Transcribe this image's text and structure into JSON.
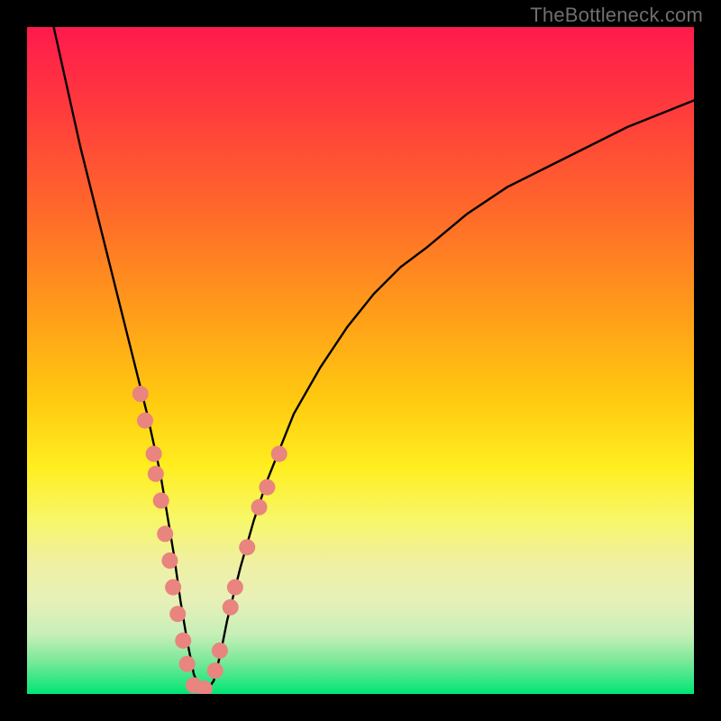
{
  "watermark": "TheBottleneck.com",
  "chart_data": {
    "type": "line",
    "title": "",
    "xlabel": "",
    "ylabel": "",
    "x_range": [
      0,
      100
    ],
    "y_range": [
      0,
      100
    ],
    "gradient_stops": [
      {
        "pos": 0,
        "color": "#ff1a4d"
      },
      {
        "pos": 28,
        "color": "#ff6a2a"
      },
      {
        "pos": 56,
        "color": "#ffca10"
      },
      {
        "pos": 74,
        "color": "#f7f76a"
      },
      {
        "pos": 95,
        "color": "#7de89a"
      },
      {
        "pos": 100,
        "color": "#00e676"
      }
    ],
    "series": [
      {
        "name": "bottleneck-curve",
        "x": [
          4,
          6,
          8,
          10,
          12,
          14,
          16,
          18,
          20,
          21,
          22,
          23,
          24,
          25,
          26,
          27,
          28,
          29,
          30,
          32,
          34,
          36,
          38,
          40,
          44,
          48,
          52,
          56,
          60,
          66,
          72,
          80,
          90,
          100
        ],
        "y": [
          100,
          91,
          82,
          74,
          66,
          58,
          50,
          42,
          33,
          27,
          21,
          14,
          8,
          3,
          0.5,
          0.5,
          2,
          6,
          11,
          19,
          26,
          32,
          37,
          42,
          49,
          55,
          60,
          64,
          67,
          72,
          76,
          80,
          85,
          89
        ]
      }
    ],
    "marker_clusters": [
      {
        "name": "left-arm-dots",
        "color": "#e9847e",
        "points": [
          {
            "x": 17.0,
            "y": 45
          },
          {
            "x": 17.7,
            "y": 41
          },
          {
            "x": 19.0,
            "y": 36
          },
          {
            "x": 19.3,
            "y": 33
          },
          {
            "x": 20.1,
            "y": 29
          },
          {
            "x": 20.7,
            "y": 24
          },
          {
            "x": 21.4,
            "y": 20
          },
          {
            "x": 21.9,
            "y": 16
          },
          {
            "x": 22.6,
            "y": 12
          },
          {
            "x": 23.4,
            "y": 8
          },
          {
            "x": 24.0,
            "y": 4.5
          },
          {
            "x": 25.0,
            "y": 1.3
          },
          {
            "x": 26.6,
            "y": 0.8
          },
          {
            "x": 28.2,
            "y": 3.5
          },
          {
            "x": 28.9,
            "y": 6.5
          }
        ]
      },
      {
        "name": "right-arm-dots",
        "color": "#e9847e",
        "points": [
          {
            "x": 30.5,
            "y": 13
          },
          {
            "x": 31.2,
            "y": 16
          },
          {
            "x": 33.0,
            "y": 22
          },
          {
            "x": 34.8,
            "y": 28
          },
          {
            "x": 36.0,
            "y": 31
          },
          {
            "x": 37.8,
            "y": 36
          }
        ]
      }
    ]
  }
}
